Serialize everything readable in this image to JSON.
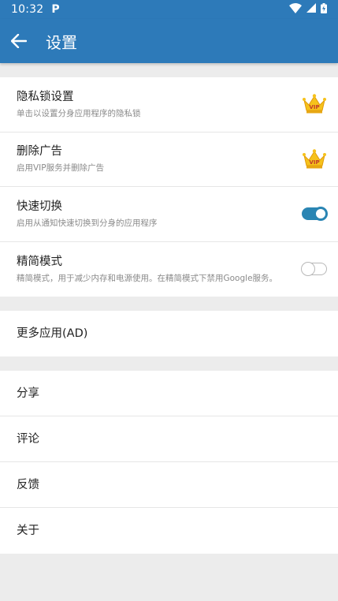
{
  "status_bar": {
    "time": "10:32",
    "notification_icon": "parking-p-icon",
    "icons": [
      "wifi-icon",
      "signal-icon",
      "battery-icon"
    ]
  },
  "app_bar": {
    "back_icon": "arrow-back-icon",
    "title": "设置"
  },
  "settings_group": [
    {
      "title": "隐私锁设置",
      "subtitle": "单击以设置分身应用程序的隐私锁",
      "trailing": "vip-crown-icon"
    },
    {
      "title": "删除广告",
      "subtitle": "启用VIP服务并删除广告",
      "trailing": "vip-crown-icon"
    },
    {
      "title": "快速切换",
      "subtitle": "启用从通知快速切换到分身的应用程序",
      "trailing": "toggle",
      "toggle_on": true
    },
    {
      "title": "精简模式",
      "subtitle": "精简模式，用于减少内存和电源使用。在精简模式下禁用Google服务。",
      "trailing": "toggle",
      "toggle_on": false
    }
  ],
  "more_group": [
    {
      "title": "更多应用(AD)"
    }
  ],
  "info_group": [
    {
      "title": "分享"
    },
    {
      "title": "评论"
    },
    {
      "title": "反馈"
    },
    {
      "title": "关于"
    }
  ],
  "vip_label": "VIP",
  "colors": {
    "primary": "#2d7ab9",
    "toggle_on": "#2a85b3",
    "background": "#ececec"
  }
}
